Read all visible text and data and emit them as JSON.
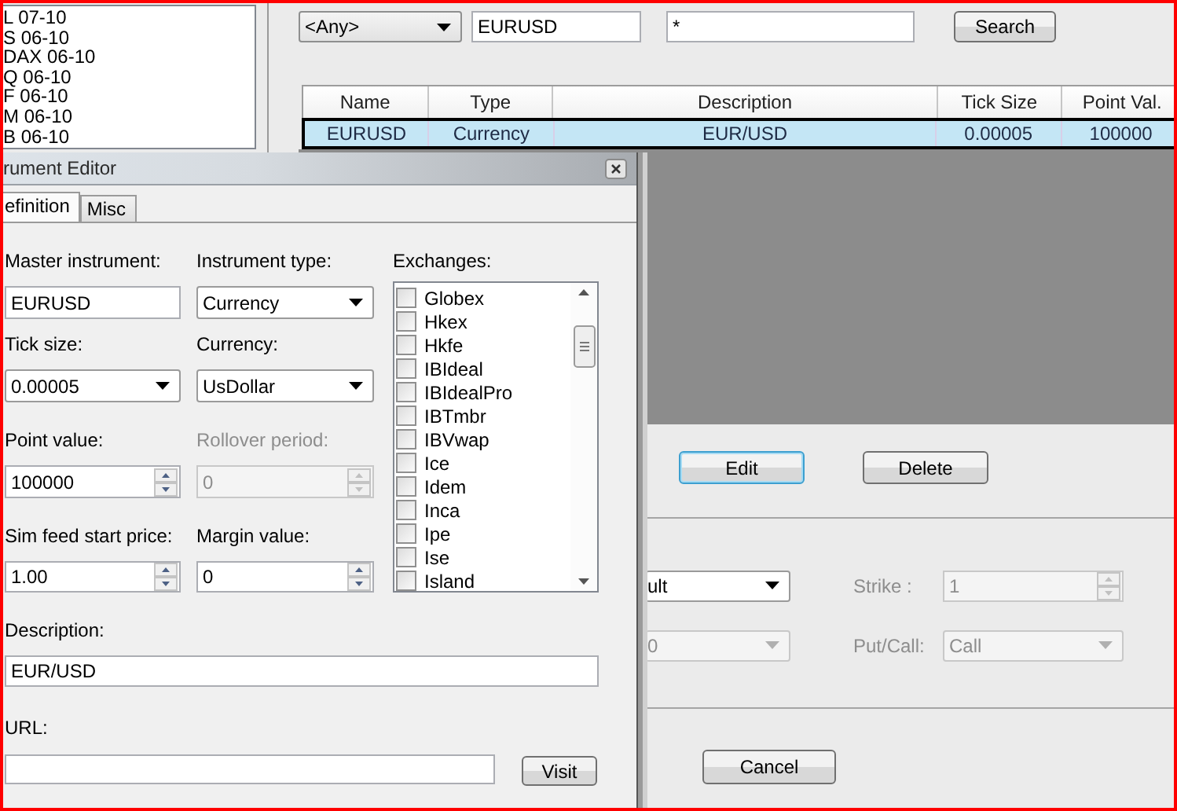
{
  "instrument_list": {
    "items": [
      {
        "label": "L 07-10"
      },
      {
        "label": "S 06-10"
      },
      {
        "label": "DAX 06-10"
      },
      {
        "label": "Q 06-10"
      },
      {
        "label": "F 06-10"
      },
      {
        "label": "M 06-10"
      },
      {
        "label": "B 06-10"
      }
    ]
  },
  "filter": {
    "type_dropdown": {
      "value": "<Any>"
    },
    "name_field": {
      "value": "EURUSD"
    },
    "description_field": {
      "value": "*"
    },
    "search_button": {
      "label": "Search"
    }
  },
  "table": {
    "columns": [
      "Name",
      "Type",
      "Description",
      "Tick Size",
      "Point Val."
    ],
    "rows": [
      {
        "cells": [
          "EURUSD",
          "Currency",
          "EUR/USD",
          "0.00005",
          "100000"
        ],
        "selected": true
      }
    ]
  },
  "actions": [
    {
      "label": "Edit",
      "focused": true
    },
    {
      "label": "Delete",
      "focused": false
    }
  ],
  "options": [
    {
      "kind": "combo",
      "value": "ult",
      "disabled": false
    },
    {
      "kind": "spin",
      "label": "Strike :",
      "value": "1",
      "disabled": true
    },
    {
      "kind": "combo",
      "value": "0",
      "disabled": true
    },
    {
      "kind": "combo",
      "label": "Put/Call:",
      "value": "Call",
      "disabled": true
    }
  ],
  "cancel_button": {
    "label": "Cancel"
  },
  "dialog": {
    "title": "rument Editor",
    "tabs": [
      {
        "label": "efinition",
        "selected": true
      },
      {
        "label": "Misc",
        "selected": false
      }
    ],
    "fields": [
      {
        "kind": "text",
        "label": "Master instrument:",
        "value": "EURUSD",
        "disabled": false
      },
      {
        "kind": "combo",
        "label": "Instrument type:",
        "value": "Currency",
        "disabled": false
      },
      {
        "kind": "combo",
        "label": "Tick size:",
        "value": "0.00005",
        "disabled": false
      },
      {
        "kind": "combo",
        "label": "Currency:",
        "value": "UsDollar",
        "disabled": false
      },
      {
        "kind": "spin",
        "label": "Point value:",
        "value": "100000",
        "disabled": false
      },
      {
        "kind": "spin",
        "label": "Rollover period:",
        "value": "0",
        "disabled": true
      },
      {
        "kind": "spin",
        "label": "Sim feed start price:",
        "value": "1.00",
        "disabled": false
      },
      {
        "kind": "spin",
        "label": "Margin value:",
        "value": "0",
        "disabled": false
      }
    ],
    "exchanges": {
      "label": "Exchanges:",
      "items": [
        {
          "label": "Globex",
          "checked": false
        },
        {
          "label": "Hkex",
          "checked": false
        },
        {
          "label": "Hkfe",
          "checked": false
        },
        {
          "label": "IBIdeal",
          "checked": false
        },
        {
          "label": "IBIdealPro",
          "checked": false
        },
        {
          "label": "IBTmbr",
          "checked": false
        },
        {
          "label": "IBVwap",
          "checked": false
        },
        {
          "label": "Ice",
          "checked": false
        },
        {
          "label": "Idem",
          "checked": false
        },
        {
          "label": "Inca",
          "checked": false
        },
        {
          "label": "Ipe",
          "checked": false
        },
        {
          "label": "Ise",
          "checked": false
        },
        {
          "label": "Island",
          "checked": false
        }
      ]
    },
    "description": {
      "label": "Description:",
      "value": "EUR/USD"
    },
    "url": {
      "label": "URL:"
    },
    "visit_button": {
      "label": "Visit"
    }
  }
}
